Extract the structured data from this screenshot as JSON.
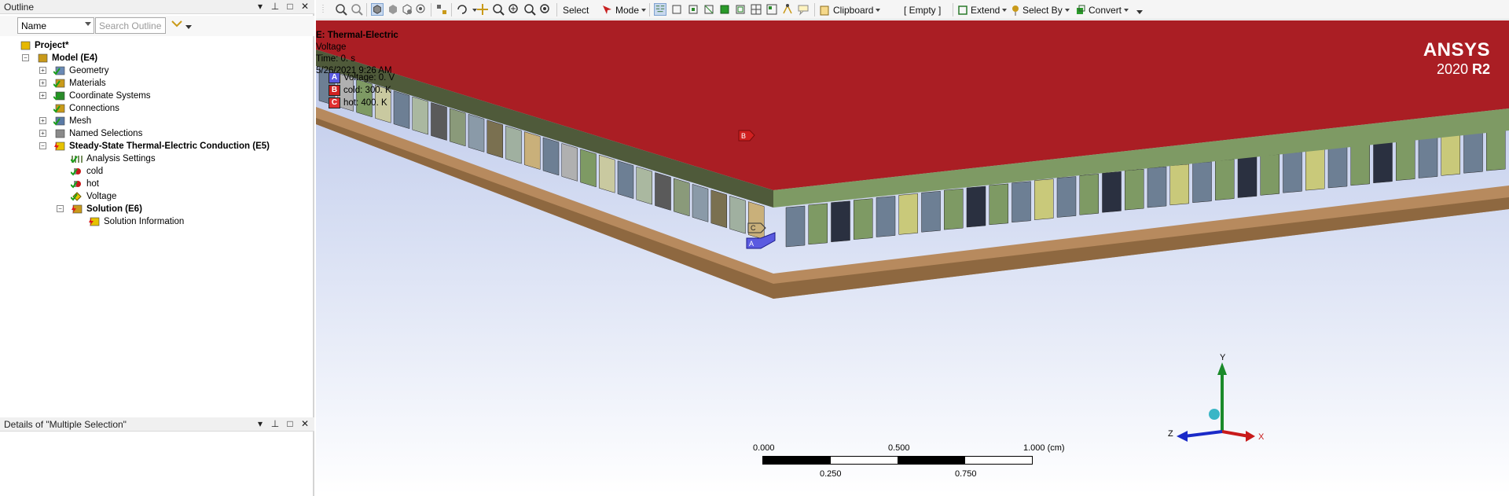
{
  "outline_panel": {
    "title": "Outline",
    "controls": [
      "▾",
      "⊥",
      "□",
      "✕"
    ],
    "name_select": "Name",
    "search_placeholder": "Search Outline"
  },
  "tree": [
    {
      "label": "Project*",
      "bold": true,
      "level": 0,
      "icon": "project-icon",
      "expander": "",
      "check": "none"
    },
    {
      "label": "Model (E4)",
      "bold": true,
      "level": 1,
      "icon": "model-icon",
      "expander": "-",
      "check": "none"
    },
    {
      "label": "Geometry",
      "bold": false,
      "level": 2,
      "icon": "geometry-icon",
      "expander": "+",
      "check": "green"
    },
    {
      "label": "Materials",
      "bold": false,
      "level": 2,
      "icon": "materials-icon",
      "expander": "+",
      "check": "green"
    },
    {
      "label": "Coordinate Systems",
      "bold": false,
      "level": 2,
      "icon": "coordinate-systems-icon",
      "expander": "+",
      "check": "green"
    },
    {
      "label": "Connections",
      "bold": false,
      "level": 2,
      "icon": "connections-icon",
      "expander": "",
      "check": "green"
    },
    {
      "label": "Mesh",
      "bold": false,
      "level": 2,
      "icon": "mesh-icon",
      "expander": "+",
      "check": "green"
    },
    {
      "label": "Named Selections",
      "bold": false,
      "level": 2,
      "icon": "named-selections-icon",
      "expander": "+",
      "check": "none"
    },
    {
      "label": "Steady-State Thermal-Electric Conduction (E5)",
      "bold": true,
      "level": 2,
      "icon": "analysis-icon",
      "expander": "-",
      "check": "lightning"
    },
    {
      "label": "Analysis Settings",
      "bold": false,
      "level": 3,
      "icon": "analysis-settings-icon",
      "expander": "",
      "check": "green"
    },
    {
      "label": "cold",
      "bold": false,
      "level": 3,
      "icon": "temperature-icon",
      "expander": "",
      "check": "green"
    },
    {
      "label": "hot",
      "bold": false,
      "level": 3,
      "icon": "temperature-icon",
      "expander": "",
      "check": "green"
    },
    {
      "label": "Voltage",
      "bold": false,
      "level": 3,
      "icon": "voltage-icon",
      "expander": "",
      "check": "green"
    },
    {
      "label": "Solution (E6)",
      "bold": true,
      "level": 3,
      "icon": "solution-icon",
      "expander": "-",
      "check": "lightning"
    },
    {
      "label": "Solution Information",
      "bold": false,
      "level": 4,
      "icon": "solution-information-icon",
      "expander": "",
      "check": "lightning"
    }
  ],
  "details_panel": {
    "title": "Details of \"Multiple Selection\"",
    "controls": [
      "▾",
      "⊥",
      "□",
      "✕"
    ]
  },
  "toolbar": {
    "select": "Select",
    "mode": "Mode",
    "clipboard": "Clipboard",
    "empty": "[ Empty ]",
    "extend": "Extend",
    "select_by": "Select By",
    "convert": "Convert"
  },
  "viewport": {
    "info_title": "E: Thermal-Electric",
    "info_lines": [
      "Voltage",
      "Time: 0. s",
      "5/26/2021 9:26 AM"
    ],
    "legend": [
      {
        "key": "A",
        "text": "Voltage: 0. V",
        "color": "#3a3ad0"
      },
      {
        "key": "B",
        "text": "cold: 300. K",
        "color": "#d02020"
      },
      {
        "key": "C",
        "text": "hot: 400. K",
        "color": "#e03030"
      }
    ],
    "brand": "ANSYS",
    "version_prefix": "2020 ",
    "version_suffix": "R2",
    "markers": {
      "a": "A",
      "b": "B",
      "c": "C"
    }
  },
  "scale_bar": {
    "top_labels": [
      "0.000",
      "0.500",
      "1.000 (cm)"
    ],
    "bottom_labels": [
      "0.250",
      "0.750"
    ]
  },
  "triad": {
    "x": "X",
    "y": "Y",
    "z": "Z"
  },
  "colors": {
    "top_plate": "#aa1e24",
    "bottom_plate": "#b78a5e",
    "legs_green": "#7e9a64",
    "legs_blue": "#6d7f94",
    "viewport_top": "#b8c4e8"
  }
}
